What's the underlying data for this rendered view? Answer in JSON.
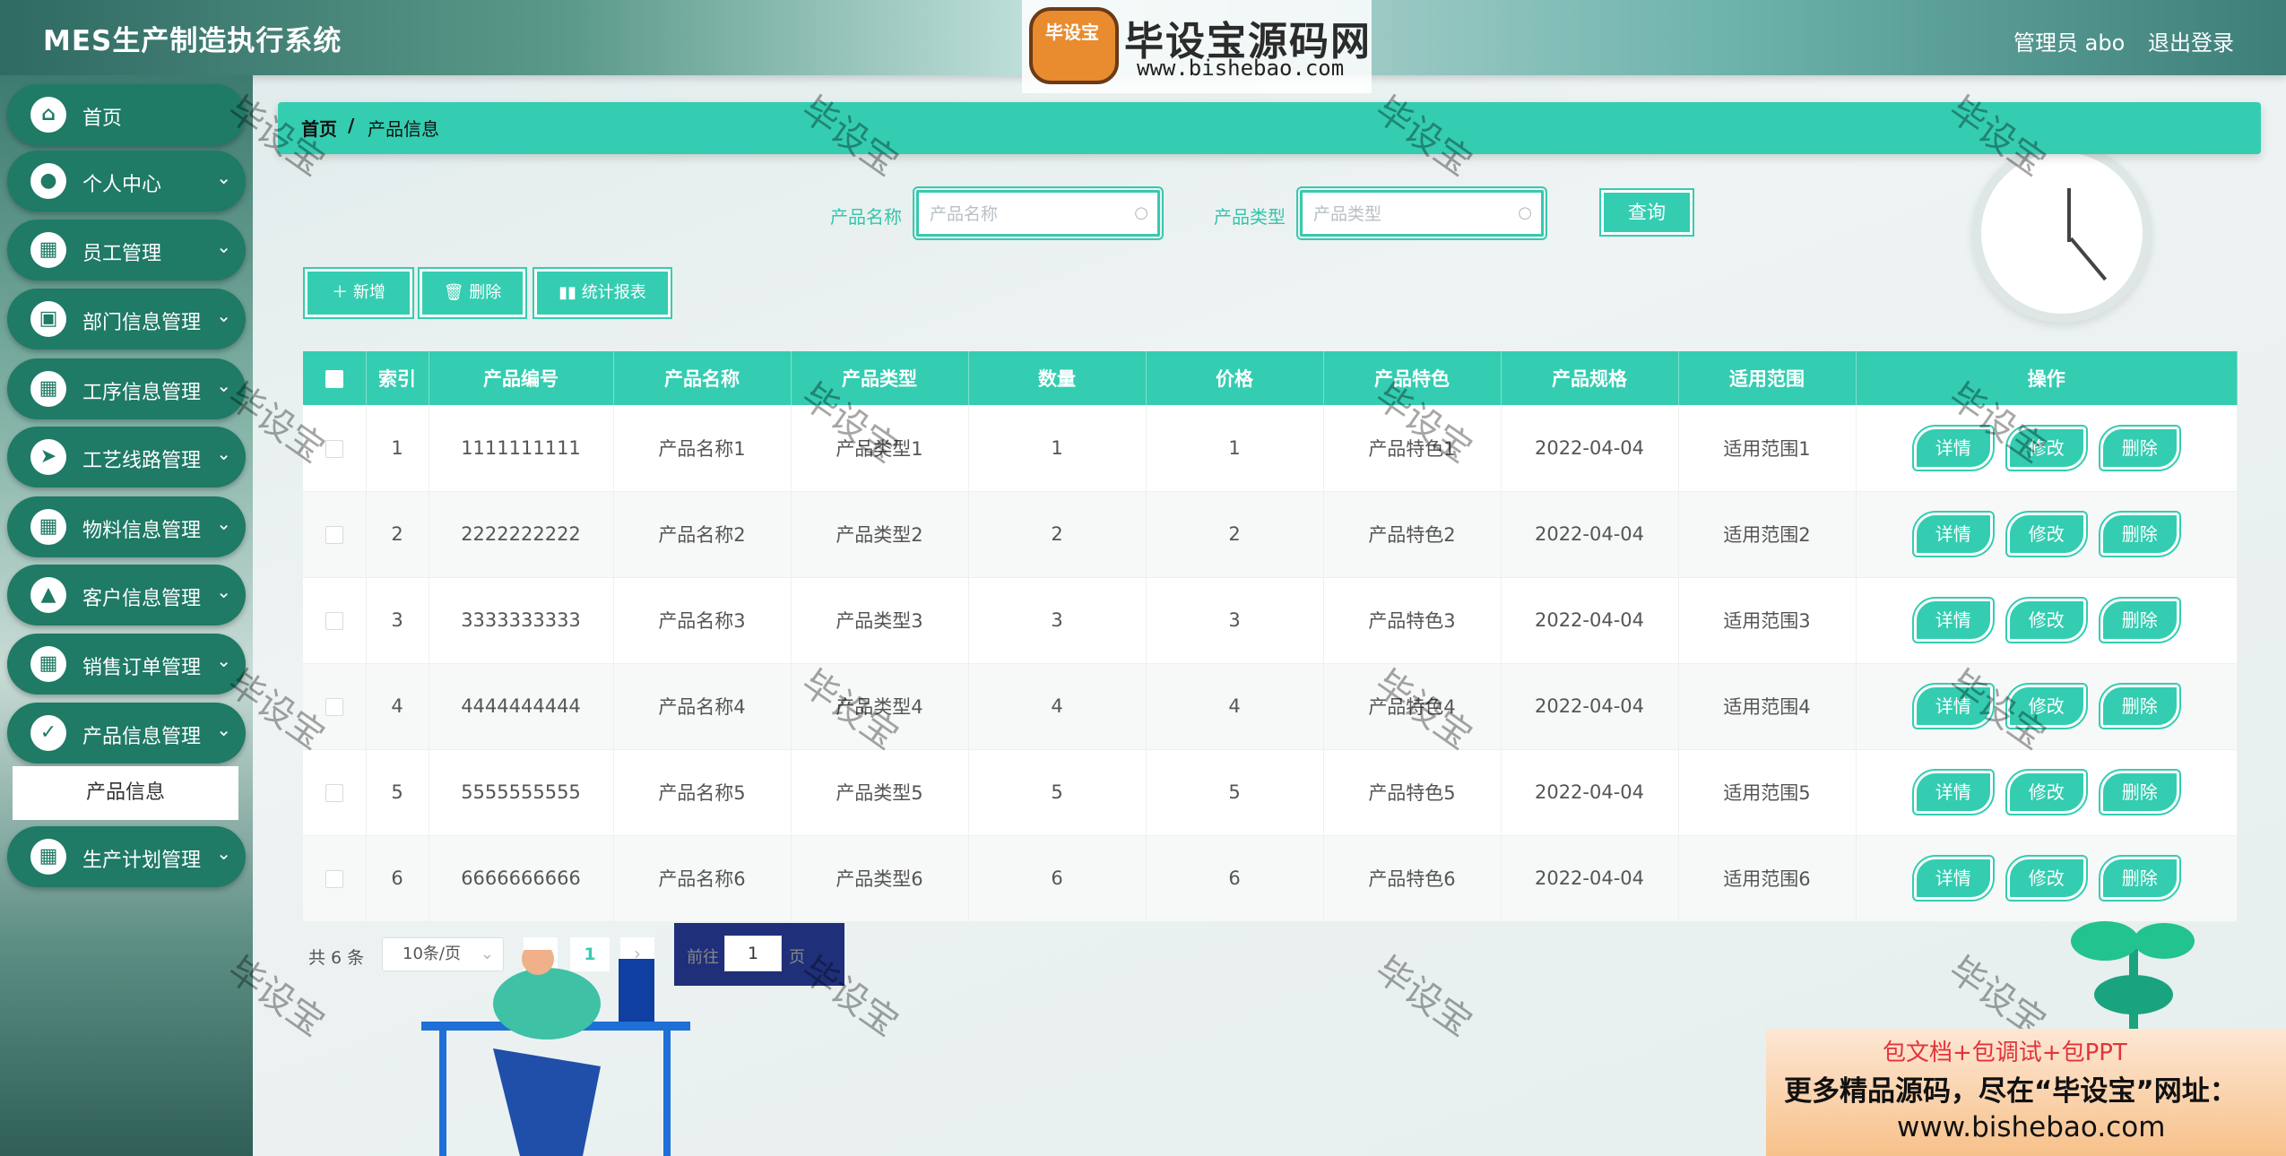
{
  "header": {
    "app_title": "MES生产制造执行系统",
    "brand_logo_text": "毕设宝",
    "brand_name": "毕设宝源码网",
    "brand_url": "www.bishebao.com",
    "user": "管理员 abo",
    "logout": "退出登录"
  },
  "sidebar": {
    "items": [
      {
        "label": "首页",
        "icon": "home-icon"
      },
      {
        "label": "个人中心",
        "icon": "user-icon"
      },
      {
        "label": "员工管理",
        "icon": "grid-icon"
      },
      {
        "label": "部门信息管理",
        "icon": "wallet-icon"
      },
      {
        "label": "工序信息管理",
        "icon": "grid-icon"
      },
      {
        "label": "工艺线路管理",
        "icon": "send-icon"
      },
      {
        "label": "物料信息管理",
        "icon": "grid-icon"
      },
      {
        "label": "客户信息管理",
        "icon": "chart-icon"
      },
      {
        "label": "销售订单管理",
        "icon": "grid-icon"
      },
      {
        "label": "产品信息管理",
        "icon": "clipboard-icon"
      },
      {
        "label": "生产计划管理",
        "icon": "grid-icon"
      }
    ],
    "submenu_active": "产品信息"
  },
  "breadcrumb": {
    "home": "首页",
    "separator": "/",
    "current": "产品信息"
  },
  "search": {
    "name_label": "产品名称",
    "name_placeholder": "产品名称",
    "type_label": "产品类型",
    "type_placeholder": "产品类型",
    "query": "查询"
  },
  "actions": {
    "add": "＋ 新增",
    "delete": "🗑 删除",
    "report": "▮▮ 统计报表"
  },
  "table": {
    "headers": [
      "索引",
      "产品编号",
      "产品名称",
      "产品类型",
      "数量",
      "价格",
      "产品特色",
      "产品规格",
      "适用范围",
      "操作"
    ],
    "rows": [
      [
        "1",
        "1111111111",
        "产品名称1",
        "产品类型1",
        "1",
        "1",
        "产品特色1",
        "2022-04-04",
        "适用范围1"
      ],
      [
        "2",
        "2222222222",
        "产品名称2",
        "产品类型2",
        "2",
        "2",
        "产品特色2",
        "2022-04-04",
        "适用范围2"
      ],
      [
        "3",
        "3333333333",
        "产品名称3",
        "产品类型3",
        "3",
        "3",
        "产品特色3",
        "2022-04-04",
        "适用范围3"
      ],
      [
        "4",
        "4444444444",
        "产品名称4",
        "产品类型4",
        "4",
        "4",
        "产品特色4",
        "2022-04-04",
        "适用范围4"
      ],
      [
        "5",
        "5555555555",
        "产品名称5",
        "产品类型5",
        "5",
        "5",
        "产品特色5",
        "2022-04-04",
        "适用范围5"
      ],
      [
        "6",
        "6666666666",
        "产品名称6",
        "产品类型6",
        "6",
        "6",
        "产品特色6",
        "2022-04-04",
        "适用范围6"
      ]
    ],
    "op_detail": "详情",
    "op_edit": "修改",
    "op_delete": "删除"
  },
  "pagination": {
    "total": "共 6 条",
    "page_size": "10条/页",
    "current_page": "1",
    "goto_label": "前往",
    "goto_value": "1",
    "goto_suffix": "页"
  },
  "watermark": "毕设宝",
  "promo": {
    "line1": "包文档+包调试+包PPT",
    "line2": "更多精品源码，尽在“毕设宝”网址：",
    "line3": "www.bishebao.com"
  },
  "colors": {
    "accent": "#34cdb1",
    "sidebar_item": "#1f7a66"
  }
}
